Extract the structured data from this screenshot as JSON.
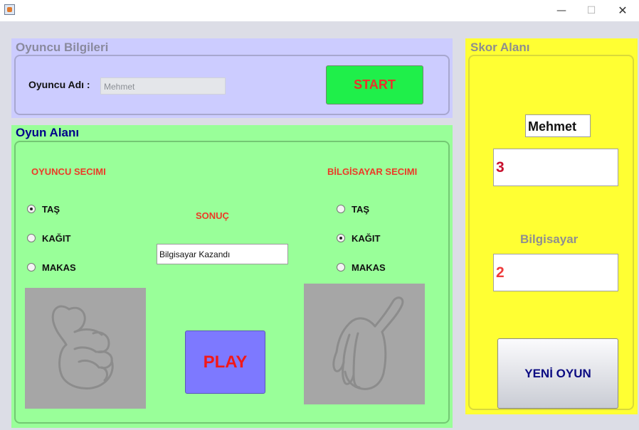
{
  "window": {
    "title": ""
  },
  "player_info": {
    "title": "Oyuncu Bilgileri",
    "name_label": "Oyuncu Adı :",
    "name_value": "Mehmet",
    "start_label": "START"
  },
  "game": {
    "title": "Oyun Alanı",
    "player_choice_label": "OYUNCU SECIMI",
    "computer_choice_label": "BİLGİSAYAR SECIMI",
    "result_label": "SONUÇ",
    "result_value": "Bilgisayar Kazandı",
    "play_label": "PLAY",
    "player_options": [
      {
        "label": "TAŞ",
        "selected": true
      },
      {
        "label": "KAĞIT",
        "selected": false
      },
      {
        "label": "MAKAS",
        "selected": false
      }
    ],
    "computer_options": [
      {
        "label": "TAŞ",
        "selected": false
      },
      {
        "label": "KAĞIT",
        "selected": true
      },
      {
        "label": "MAKAS",
        "selected": false
      }
    ],
    "player_image": "fist-icon",
    "computer_image": "open-hand-icon"
  },
  "score": {
    "title": "Skor Alanı",
    "player_name": "Mehmet",
    "player_score": "3",
    "computer_label": "Bilgisayar",
    "computer_score": "2",
    "new_game_label": "YENİ OYUN"
  },
  "colors": {
    "player_panel": "#ccccff",
    "game_panel": "#99ff99",
    "score_panel": "#ffff33",
    "start_button": "#1fef4a",
    "play_button": "#7d79ff",
    "accent_red": "#ec3a27",
    "player_score_color": "#c8102e",
    "computer_score_color": "#ef3b3b"
  }
}
